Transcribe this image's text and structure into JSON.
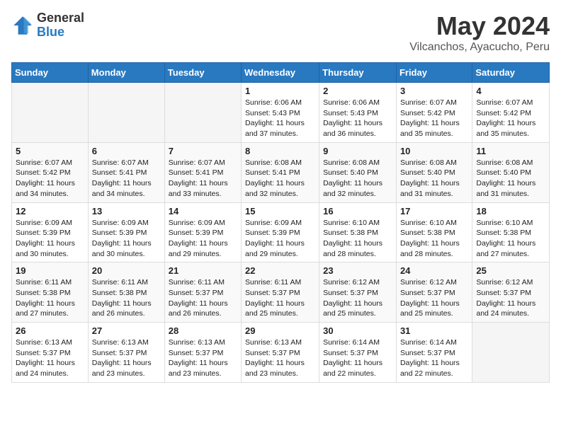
{
  "header": {
    "logo_general": "General",
    "logo_blue": "Blue",
    "month_year": "May 2024",
    "location": "Vilcanchos, Ayacucho, Peru"
  },
  "days_of_week": [
    "Sunday",
    "Monday",
    "Tuesday",
    "Wednesday",
    "Thursday",
    "Friday",
    "Saturday"
  ],
  "weeks": [
    [
      {
        "day": "",
        "info": ""
      },
      {
        "day": "",
        "info": ""
      },
      {
        "day": "",
        "info": ""
      },
      {
        "day": "1",
        "info": "Sunrise: 6:06 AM\nSunset: 5:43 PM\nDaylight: 11 hours and 37 minutes."
      },
      {
        "day": "2",
        "info": "Sunrise: 6:06 AM\nSunset: 5:43 PM\nDaylight: 11 hours and 36 minutes."
      },
      {
        "day": "3",
        "info": "Sunrise: 6:07 AM\nSunset: 5:42 PM\nDaylight: 11 hours and 35 minutes."
      },
      {
        "day": "4",
        "info": "Sunrise: 6:07 AM\nSunset: 5:42 PM\nDaylight: 11 hours and 35 minutes."
      }
    ],
    [
      {
        "day": "5",
        "info": "Sunrise: 6:07 AM\nSunset: 5:42 PM\nDaylight: 11 hours and 34 minutes."
      },
      {
        "day": "6",
        "info": "Sunrise: 6:07 AM\nSunset: 5:41 PM\nDaylight: 11 hours and 34 minutes."
      },
      {
        "day": "7",
        "info": "Sunrise: 6:07 AM\nSunset: 5:41 PM\nDaylight: 11 hours and 33 minutes."
      },
      {
        "day": "8",
        "info": "Sunrise: 6:08 AM\nSunset: 5:41 PM\nDaylight: 11 hours and 32 minutes."
      },
      {
        "day": "9",
        "info": "Sunrise: 6:08 AM\nSunset: 5:40 PM\nDaylight: 11 hours and 32 minutes."
      },
      {
        "day": "10",
        "info": "Sunrise: 6:08 AM\nSunset: 5:40 PM\nDaylight: 11 hours and 31 minutes."
      },
      {
        "day": "11",
        "info": "Sunrise: 6:08 AM\nSunset: 5:40 PM\nDaylight: 11 hours and 31 minutes."
      }
    ],
    [
      {
        "day": "12",
        "info": "Sunrise: 6:09 AM\nSunset: 5:39 PM\nDaylight: 11 hours and 30 minutes."
      },
      {
        "day": "13",
        "info": "Sunrise: 6:09 AM\nSunset: 5:39 PM\nDaylight: 11 hours and 30 minutes."
      },
      {
        "day": "14",
        "info": "Sunrise: 6:09 AM\nSunset: 5:39 PM\nDaylight: 11 hours and 29 minutes."
      },
      {
        "day": "15",
        "info": "Sunrise: 6:09 AM\nSunset: 5:39 PM\nDaylight: 11 hours and 29 minutes."
      },
      {
        "day": "16",
        "info": "Sunrise: 6:10 AM\nSunset: 5:38 PM\nDaylight: 11 hours and 28 minutes."
      },
      {
        "day": "17",
        "info": "Sunrise: 6:10 AM\nSunset: 5:38 PM\nDaylight: 11 hours and 28 minutes."
      },
      {
        "day": "18",
        "info": "Sunrise: 6:10 AM\nSunset: 5:38 PM\nDaylight: 11 hours and 27 minutes."
      }
    ],
    [
      {
        "day": "19",
        "info": "Sunrise: 6:11 AM\nSunset: 5:38 PM\nDaylight: 11 hours and 27 minutes."
      },
      {
        "day": "20",
        "info": "Sunrise: 6:11 AM\nSunset: 5:38 PM\nDaylight: 11 hours and 26 minutes."
      },
      {
        "day": "21",
        "info": "Sunrise: 6:11 AM\nSunset: 5:37 PM\nDaylight: 11 hours and 26 minutes."
      },
      {
        "day": "22",
        "info": "Sunrise: 6:11 AM\nSunset: 5:37 PM\nDaylight: 11 hours and 25 minutes."
      },
      {
        "day": "23",
        "info": "Sunrise: 6:12 AM\nSunset: 5:37 PM\nDaylight: 11 hours and 25 minutes."
      },
      {
        "day": "24",
        "info": "Sunrise: 6:12 AM\nSunset: 5:37 PM\nDaylight: 11 hours and 25 minutes."
      },
      {
        "day": "25",
        "info": "Sunrise: 6:12 AM\nSunset: 5:37 PM\nDaylight: 11 hours and 24 minutes."
      }
    ],
    [
      {
        "day": "26",
        "info": "Sunrise: 6:13 AM\nSunset: 5:37 PM\nDaylight: 11 hours and 24 minutes."
      },
      {
        "day": "27",
        "info": "Sunrise: 6:13 AM\nSunset: 5:37 PM\nDaylight: 11 hours and 23 minutes."
      },
      {
        "day": "28",
        "info": "Sunrise: 6:13 AM\nSunset: 5:37 PM\nDaylight: 11 hours and 23 minutes."
      },
      {
        "day": "29",
        "info": "Sunrise: 6:13 AM\nSunset: 5:37 PM\nDaylight: 11 hours and 23 minutes."
      },
      {
        "day": "30",
        "info": "Sunrise: 6:14 AM\nSunset: 5:37 PM\nDaylight: 11 hours and 22 minutes."
      },
      {
        "day": "31",
        "info": "Sunrise: 6:14 AM\nSunset: 5:37 PM\nDaylight: 11 hours and 22 minutes."
      },
      {
        "day": "",
        "info": ""
      }
    ]
  ]
}
